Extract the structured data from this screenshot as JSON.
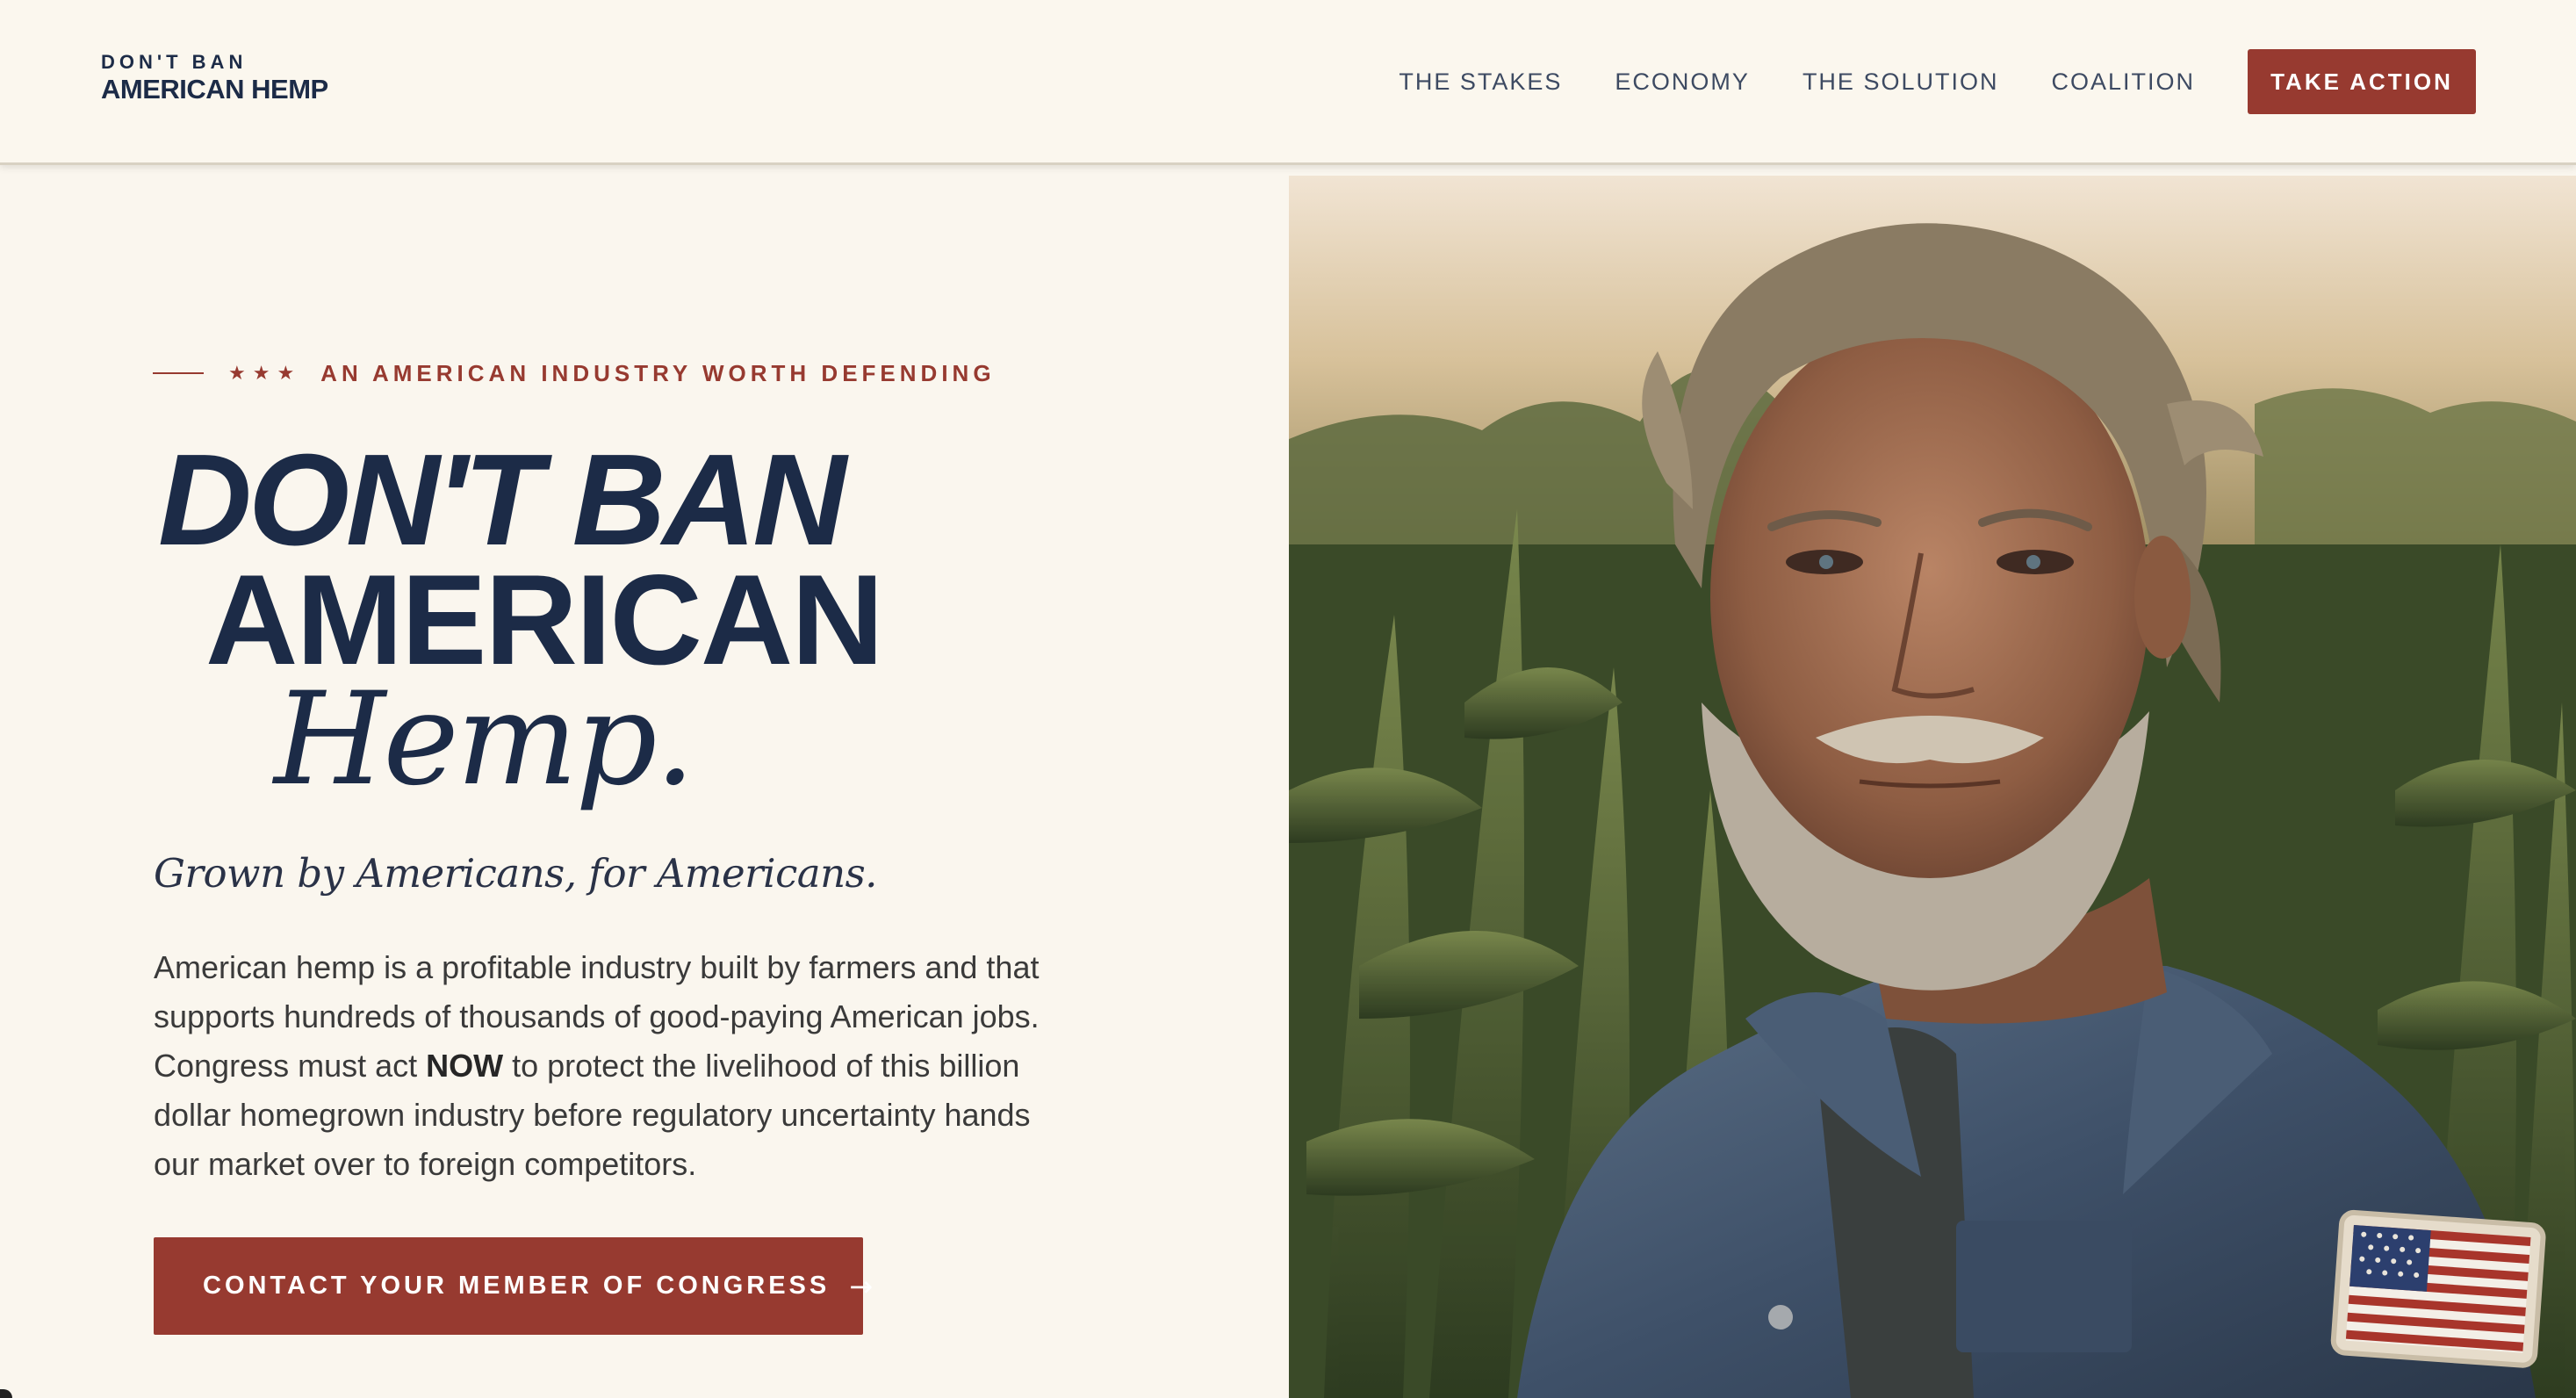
{
  "header": {
    "logo_top": "DON'T BAN",
    "logo_main": "AMERICAN HEMP",
    "nav": [
      "THE STAKES",
      "ECONOMY",
      "THE SOLUTION",
      "COALITION"
    ],
    "cta": "TAKE ACTION"
  },
  "hero": {
    "eyebrow_stars": "★★★",
    "eyebrow": "AN AMERICAN INDUSTRY WORTH DEFENDING",
    "headline_line1": "DON'T BAN",
    "headline_line2": "AMERICAN",
    "headline_line3": "Hemp.",
    "tagline": "Grown by Americans, for Americans.",
    "body_before": "American hemp is a profitable industry built by farmers and that supports hundreds of thousands of good-paying American jobs. Congress must act ",
    "body_bold": "NOW",
    "body_after": " to protect the livelihood of this billion dollar homegrown industry before regulatory uncertainty hands our market over to foreign competitors.",
    "cta": "CONTACT YOUR MEMBER OF CONGRESS",
    "cta_arrow": "→"
  },
  "colors": {
    "navy": "#1c2b47",
    "brick_red": "#973a30",
    "cream": "#faf6ee"
  },
  "icons": {
    "cta_arrow": "arrow-right-icon",
    "eyebrow": "star-icon"
  }
}
